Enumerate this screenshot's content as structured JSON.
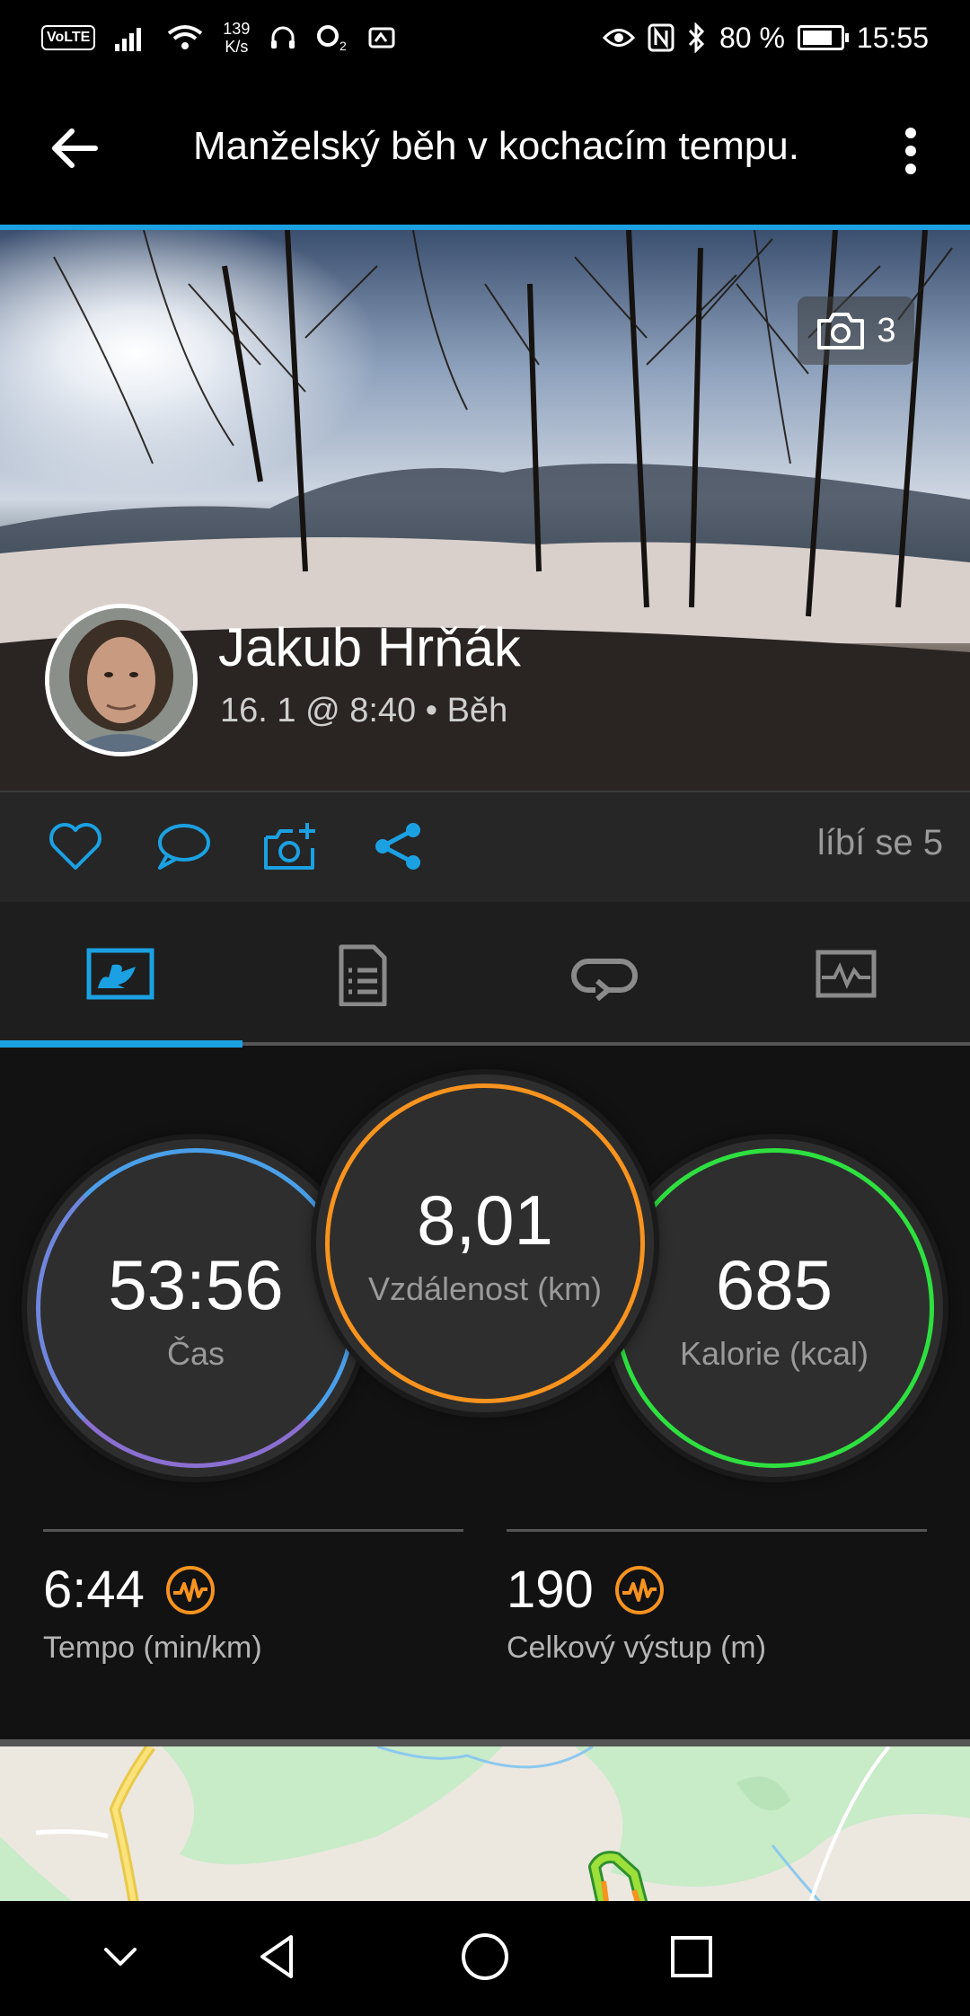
{
  "status_bar": {
    "volte": "VoLTE",
    "speed_value": "139",
    "speed_unit": "K/s",
    "battery": "80 %",
    "time": "15:55"
  },
  "header": {
    "title": "Manželský běh v kochacím tempu.",
    "icons": [
      "back-arrow-icon",
      "more-vert-icon"
    ]
  },
  "hero": {
    "photo_count": "3",
    "user_name": "Jakub Hrňák",
    "meta": "16. 1 @ 8:40 • Běh"
  },
  "actions": {
    "icons": [
      "heart-icon",
      "comment-icon",
      "add-photo-icon",
      "share-icon"
    ],
    "likes": "líbí se 5",
    "accent": "#1ba1e2"
  },
  "tabs": {
    "icons": [
      "overview-icon",
      "details-icon",
      "laps-icon",
      "chart-icon"
    ],
    "selected": 0
  },
  "stats": {
    "time": {
      "value": "53:56",
      "label": "Čas"
    },
    "distance": {
      "value": "8,01",
      "label": "Vzdálenost (km)"
    },
    "calories": {
      "value": "685",
      "label": "Kalorie (kcal)"
    },
    "pace": {
      "value": "6:44",
      "label": "Tempo (min/km)"
    },
    "ascent": {
      "value": "190",
      "label": "Celkový výstup (m)"
    },
    "colors": {
      "time": "#4a9fe8",
      "time_end": "#8a6fd1",
      "distance": "#f7931e",
      "calories": "#2ee03f",
      "badge": "#f7931e"
    }
  },
  "navbar": {
    "icons": [
      "chevron-down-icon",
      "nav-back-icon",
      "nav-home-icon",
      "nav-recents-icon"
    ]
  }
}
